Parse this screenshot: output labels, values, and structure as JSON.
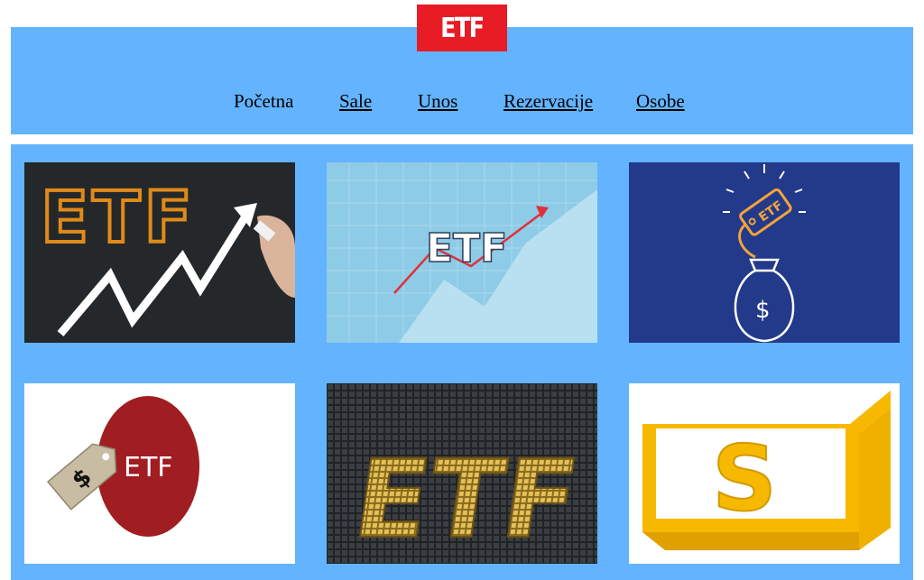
{
  "logo": {
    "text": "ETF",
    "color": "#e81c24"
  },
  "nav": {
    "items": [
      {
        "label": "Početna",
        "active": true
      },
      {
        "label": "Sale",
        "active": false
      },
      {
        "label": "Unos",
        "active": false
      },
      {
        "label": "Rezervacije",
        "active": false
      },
      {
        "label": "Osobe",
        "active": false
      }
    ]
  },
  "gallery": {
    "tiles": [
      {
        "name": "chalkboard-arrow",
        "text": "ETF"
      },
      {
        "name": "line-chart",
        "text": "ETF"
      },
      {
        "name": "money-bag-tag",
        "text": "ETF",
        "tag_text": "ETF",
        "symbol": "$"
      },
      {
        "name": "price-tag-circle",
        "text": "ETF",
        "symbol": "$"
      },
      {
        "name": "gold-cubes",
        "text": "ETF"
      },
      {
        "name": "yellow-box-s",
        "text": "S"
      }
    ]
  },
  "colors": {
    "panel": "#63b3ff",
    "background": "#ffffff",
    "accent": "#e81c24"
  }
}
